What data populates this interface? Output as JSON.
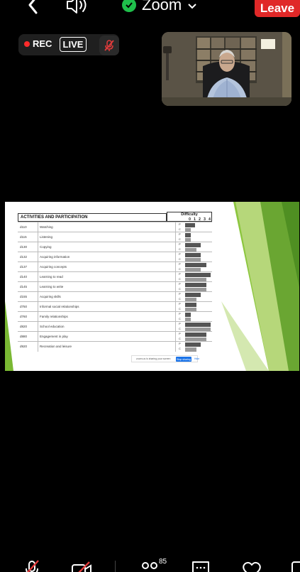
{
  "header": {
    "title": "Zoom",
    "leave_label": "Leave"
  },
  "status": {
    "rec_label": "REC",
    "live_label": "LIVE"
  },
  "shared_sheet": {
    "title": "ACTIVITIES AND PARTICIPATION",
    "difficulty_label": "Difficulty",
    "scale": [
      "0",
      "1",
      "2",
      "3",
      "4"
    ],
    "rows": [
      {
        "code": "d110",
        "name": "Watching"
      },
      {
        "code": "d115",
        "name": "Listening"
      },
      {
        "code": "d130",
        "name": "Copying"
      },
      {
        "code": "d132",
        "name": "Acquiring information"
      },
      {
        "code": "d137",
        "name": "Acquiring concepts"
      },
      {
        "code": "d140",
        "name": "Learning to read"
      },
      {
        "code": "d145",
        "name": "Learning to write"
      },
      {
        "code": "d155",
        "name": "Acquiring skills"
      },
      {
        "code": "d750",
        "name": "Informal social relationships"
      },
      {
        "code": "d760",
        "name": "Family relationships"
      },
      {
        "code": "d820",
        "name": "School education"
      },
      {
        "code": "d880",
        "name": "Engagement in play"
      },
      {
        "code": "d920",
        "name": "Recreation and leisure"
      }
    ],
    "pc": [
      "P",
      "C"
    ],
    "notice": {
      "text": "zoom.us is sharing your screen",
      "stop_label": "Stop sharing",
      "hide_label": "Hide"
    }
  },
  "toolbar": {
    "participants_count": "85"
  },
  "colors": {
    "leave": "#e02828",
    "rec_dot": "#ff2b2b",
    "verified": "#1fbf4b",
    "slide_green": "#7ab833"
  }
}
